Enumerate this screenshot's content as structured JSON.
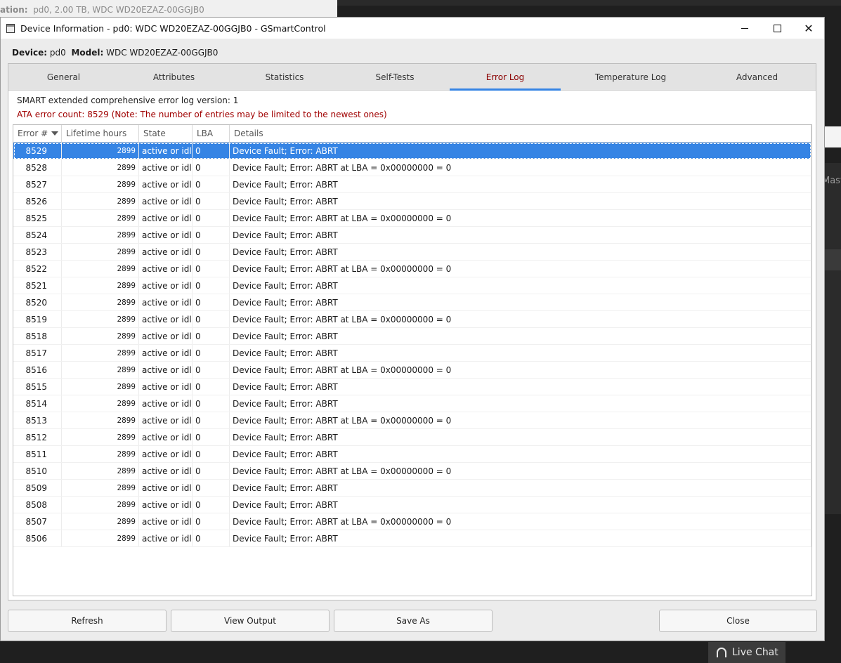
{
  "background": {
    "top_window_label": "ation:",
    "top_window_text": "pd0, 2.00 TB, WDC WD20EZAZ-00GGJB0",
    "side_text": "Mast",
    "live_chat": "Live Chat"
  },
  "window": {
    "title": "Device Information - pd0: WDC WD20EZAZ-00GGJB0 - GSmartControl",
    "controls": {
      "minimize": "minimize-icon",
      "maximize": "maximize-icon",
      "close": "close-icon"
    },
    "close_glyph": "✕"
  },
  "device": {
    "device_label": "Device:",
    "device_value": "pd0",
    "model_label": "Model:",
    "model_value": "WDC WD20EZAZ-00GGJB0"
  },
  "tabs": [
    {
      "label": "General"
    },
    {
      "label": "Attributes"
    },
    {
      "label": "Statistics"
    },
    {
      "label": "Self-Tests"
    },
    {
      "label": "Error Log",
      "active": true
    },
    {
      "label": "Temperature Log"
    },
    {
      "label": "Advanced"
    }
  ],
  "error_log": {
    "version_line": "SMART extended comprehensive error log version: 1",
    "count_line": "ATA error count: 8529 (Note: The number of entries may be limited to the newest ones)",
    "columns": [
      "Error #",
      "Lifetime hours",
      "State",
      "LBA",
      "Details"
    ],
    "sorted_column": "Error #",
    "selected_row": 0,
    "rows": [
      {
        "num": "8529",
        "hours": "2899",
        "state": "active or idle",
        "lba": "0",
        "details": "Device Fault; Error: ABRT"
      },
      {
        "num": "8528",
        "hours": "2899",
        "state": "active or idle",
        "lba": "0",
        "details": "Device Fault; Error: ABRT at LBA = 0x00000000 = 0"
      },
      {
        "num": "8527",
        "hours": "2899",
        "state": "active or idle",
        "lba": "0",
        "details": "Device Fault; Error: ABRT"
      },
      {
        "num": "8526",
        "hours": "2899",
        "state": "active or idle",
        "lba": "0",
        "details": "Device Fault; Error: ABRT"
      },
      {
        "num": "8525",
        "hours": "2899",
        "state": "active or idle",
        "lba": "0",
        "details": "Device Fault; Error: ABRT at LBA = 0x00000000 = 0"
      },
      {
        "num": "8524",
        "hours": "2899",
        "state": "active or idle",
        "lba": "0",
        "details": "Device Fault; Error: ABRT"
      },
      {
        "num": "8523",
        "hours": "2899",
        "state": "active or idle",
        "lba": "0",
        "details": "Device Fault; Error: ABRT"
      },
      {
        "num": "8522",
        "hours": "2899",
        "state": "active or idle",
        "lba": "0",
        "details": "Device Fault; Error: ABRT at LBA = 0x00000000 = 0"
      },
      {
        "num": "8521",
        "hours": "2899",
        "state": "active or idle",
        "lba": "0",
        "details": "Device Fault; Error: ABRT"
      },
      {
        "num": "8520",
        "hours": "2899",
        "state": "active or idle",
        "lba": "0",
        "details": "Device Fault; Error: ABRT"
      },
      {
        "num": "8519",
        "hours": "2899",
        "state": "active or idle",
        "lba": "0",
        "details": "Device Fault; Error: ABRT at LBA = 0x00000000 = 0"
      },
      {
        "num": "8518",
        "hours": "2899",
        "state": "active or idle",
        "lba": "0",
        "details": "Device Fault; Error: ABRT"
      },
      {
        "num": "8517",
        "hours": "2899",
        "state": "active or idle",
        "lba": "0",
        "details": "Device Fault; Error: ABRT"
      },
      {
        "num": "8516",
        "hours": "2899",
        "state": "active or idle",
        "lba": "0",
        "details": "Device Fault; Error: ABRT at LBA = 0x00000000 = 0"
      },
      {
        "num": "8515",
        "hours": "2899",
        "state": "active or idle",
        "lba": "0",
        "details": "Device Fault; Error: ABRT"
      },
      {
        "num": "8514",
        "hours": "2899",
        "state": "active or idle",
        "lba": "0",
        "details": "Device Fault; Error: ABRT"
      },
      {
        "num": "8513",
        "hours": "2899",
        "state": "active or idle",
        "lba": "0",
        "details": "Device Fault; Error: ABRT at LBA = 0x00000000 = 0"
      },
      {
        "num": "8512",
        "hours": "2899",
        "state": "active or idle",
        "lba": "0",
        "details": "Device Fault; Error: ABRT"
      },
      {
        "num": "8511",
        "hours": "2899",
        "state": "active or idle",
        "lba": "0",
        "details": "Device Fault; Error: ABRT"
      },
      {
        "num": "8510",
        "hours": "2899",
        "state": "active or idle",
        "lba": "0",
        "details": "Device Fault; Error: ABRT at LBA = 0x00000000 = 0"
      },
      {
        "num": "8509",
        "hours": "2899",
        "state": "active or idle",
        "lba": "0",
        "details": "Device Fault; Error: ABRT"
      },
      {
        "num": "8508",
        "hours": "2899",
        "state": "active or idle",
        "lba": "0",
        "details": "Device Fault; Error: ABRT"
      },
      {
        "num": "8507",
        "hours": "2899",
        "state": "active or idle",
        "lba": "0",
        "details": "Device Fault; Error: ABRT at LBA = 0x00000000 = 0"
      },
      {
        "num": "8506",
        "hours": "2899",
        "state": "active or idle",
        "lba": "0",
        "details": "Device Fault; Error: ABRT"
      }
    ]
  },
  "buttons": {
    "refresh": "Refresh",
    "view_output": "View Output",
    "save_as": "Save As",
    "close": "Close"
  },
  "colors": {
    "accent": "#3584e4",
    "error_text": "#a00000",
    "active_tab_text": "#8b0000"
  }
}
